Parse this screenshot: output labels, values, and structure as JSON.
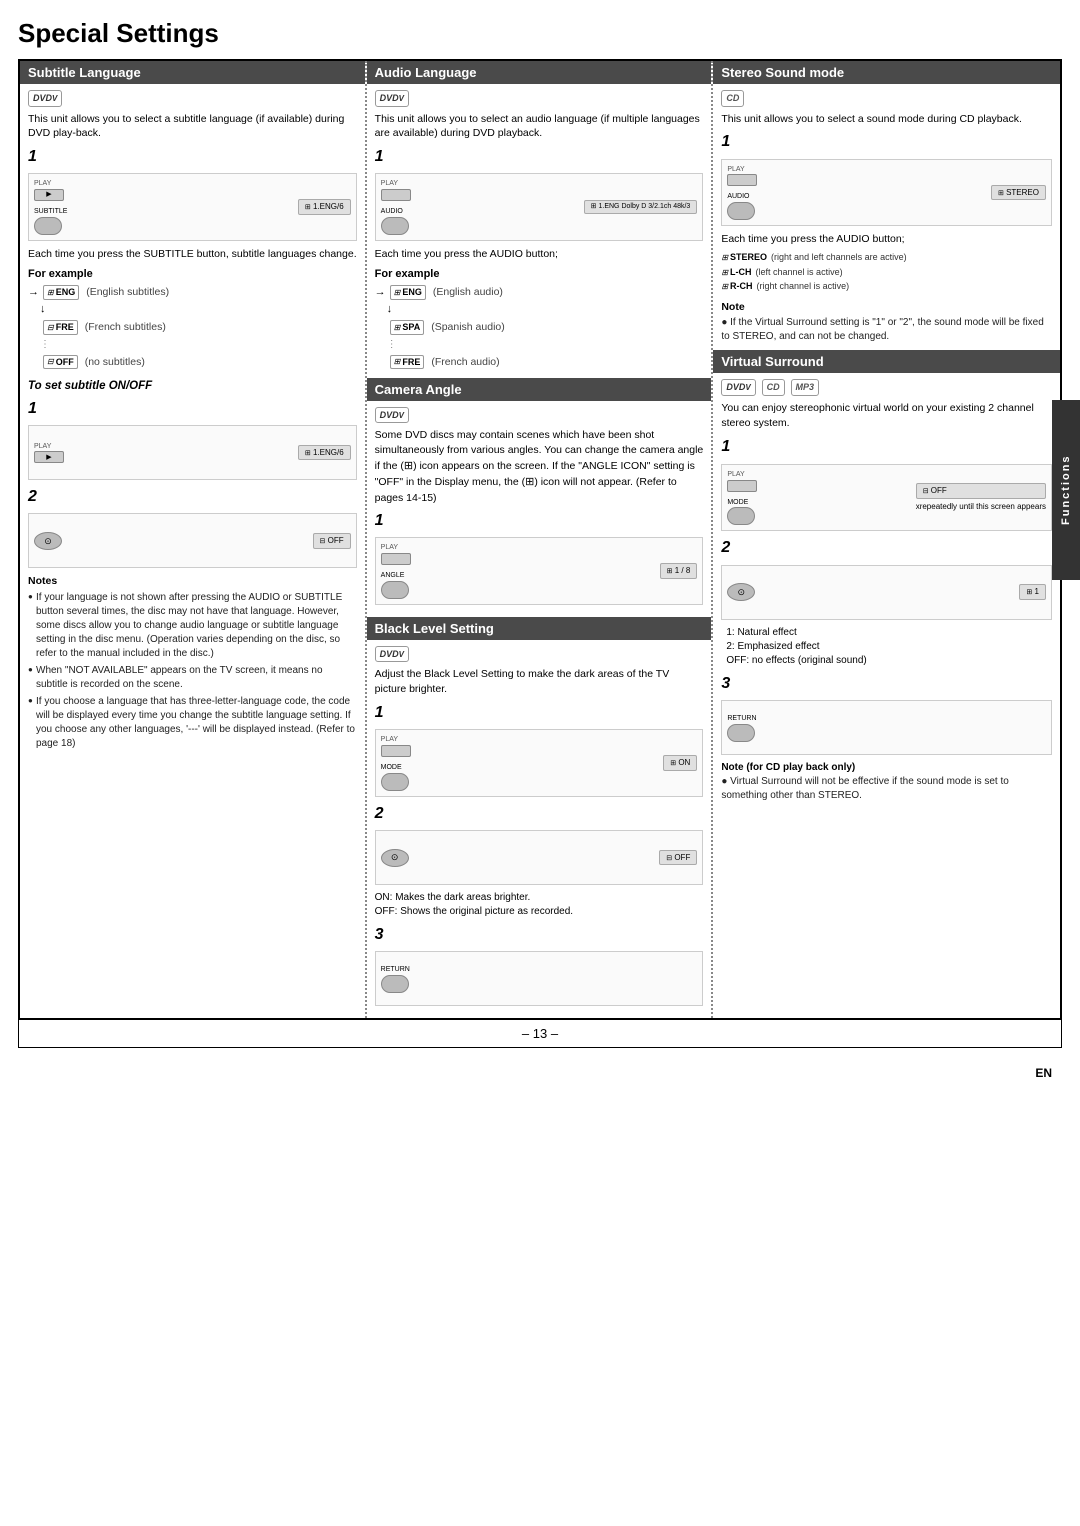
{
  "page": {
    "title": "Special Settings",
    "page_number": "– 13 –",
    "en_label": "EN"
  },
  "functions_tab": "Functions",
  "col1": {
    "section1": {
      "header": "Subtitle Language",
      "badge": "DVD",
      "intro": "This unit allows you to select a subtitle language (if available) during DVD play-back.",
      "step1_label": "1",
      "step1_screen": "1.ENG/6",
      "press_text": "Each time you press the SUBTITLE button, subtitle languages change.",
      "for_example": "For example",
      "examples": [
        {
          "arrow": "→",
          "code": "ENG",
          "desc": "(English subtitles)"
        },
        {
          "arrow": "↓",
          "code": "FRE",
          "desc": "(French subtitles)"
        },
        {
          "arrow": "↓",
          "code": "OFF",
          "desc": "(no subtitles)"
        }
      ],
      "subtitle_on_off": "To set subtitle ON/OFF",
      "step_on_screen": "1.ENG/6",
      "step2_screen": "OFF",
      "notes_title": "Notes",
      "notes": [
        "If your language is not shown after pressing the AUDIO or SUBTITLE button several times, the disc may not have that language. However, some discs allow you to change audio language or subtitle language setting in the disc menu. (Operation varies depending on the disc, so refer to the manual included in the disc.)",
        "When \"NOT AVAILABLE\" appears on the TV screen, it means no subtitle is recorded on the scene.",
        "If you choose a language that has three-letter-language code, the code will be displayed every time you change the subtitle language setting. If you choose any other languages, '---' will be displayed instead. (Refer to page 18)"
      ]
    }
  },
  "col2": {
    "section1": {
      "header": "Audio Language",
      "badge": "DVD",
      "intro": "This unit allows you to select an audio language (if multiple languages are available) during DVD playback.",
      "step1_label": "1",
      "step1_screen": "1.ENG Dolby D 3/2.1ch 48k/3",
      "press_text": "Each time you press the AUDIO button;",
      "for_example": "For example",
      "examples": [
        {
          "arrow": "→",
          "code": "ENG",
          "desc": "(English audio)"
        },
        {
          "arrow": "↓",
          "code": "SPA",
          "desc": "(Spanish audio)"
        },
        {
          "arrow": "↓",
          "code": "FRE",
          "desc": "(French audio)"
        }
      ]
    },
    "section2": {
      "header": "Camera Angle",
      "badge": "DVD",
      "text": "Some DVD discs may contain scenes which have been shot simultaneously from various angles. You can change the camera angle if the ( ) icon appears on the screen. If the \"ANGLE ICON\" setting is \"OFF\" in the Display menu, the ( ) icon will not appear. (Refer to pages 14-15)",
      "step1_label": "1",
      "step1_screen": "1 / 8"
    },
    "section3": {
      "header": "Black Level Setting",
      "badge": "DVD",
      "intro": "Adjust the Black Level Setting to make the dark areas of the TV picture brighter.",
      "step1_label": "1",
      "step1_screen": "ON",
      "step2_label": "2",
      "step2_screen": "OFF",
      "on_text": "ON: Makes the dark areas brighter.",
      "off_text": "OFF: Shows the original picture as recorded.",
      "step3_label": "3"
    }
  },
  "col3": {
    "section1": {
      "header": "Stereo Sound mode",
      "badge": "CD",
      "intro": "This unit allows you to select a sound mode during CD playback.",
      "step1_label": "1",
      "step1_screen": "STEREO",
      "press_text": "Each time you press the AUDIO button;",
      "stereo_rows": [
        {
          "code": "STEREO",
          "desc": "(right and left channels are active)"
        },
        {
          "code": "L-CH",
          "desc": "(left channel is active)"
        },
        {
          "code": "R-CH",
          "desc": "(right channel is active)"
        }
      ],
      "note_title": "Note",
      "note_text": "● If the Virtual Surround setting is \"1\" or \"2\", the sound mode will be fixed to STEREO, and can not be changed."
    },
    "section2": {
      "header": "Virtual Surround",
      "badges": [
        "DVD",
        "CD",
        "MP3"
      ],
      "intro": "You can enjoy stereophonic virtual world on your existing 2 channel stereo system.",
      "step1_label": "1",
      "step1_screen": "OFF",
      "step1_note": "xrepeatedly until this screen appears",
      "step2_label": "2",
      "step2_screen": "1",
      "effects": [
        "1: Natural effect",
        "2: Emphasized effect",
        "OFF: no effects (original sound)"
      ],
      "step3_label": "3",
      "note_cd_title": "Note (for CD play back only)",
      "note_cd_text": "● Virtual Surround will not be effective if the sound mode is set to something other than STEREO."
    }
  }
}
